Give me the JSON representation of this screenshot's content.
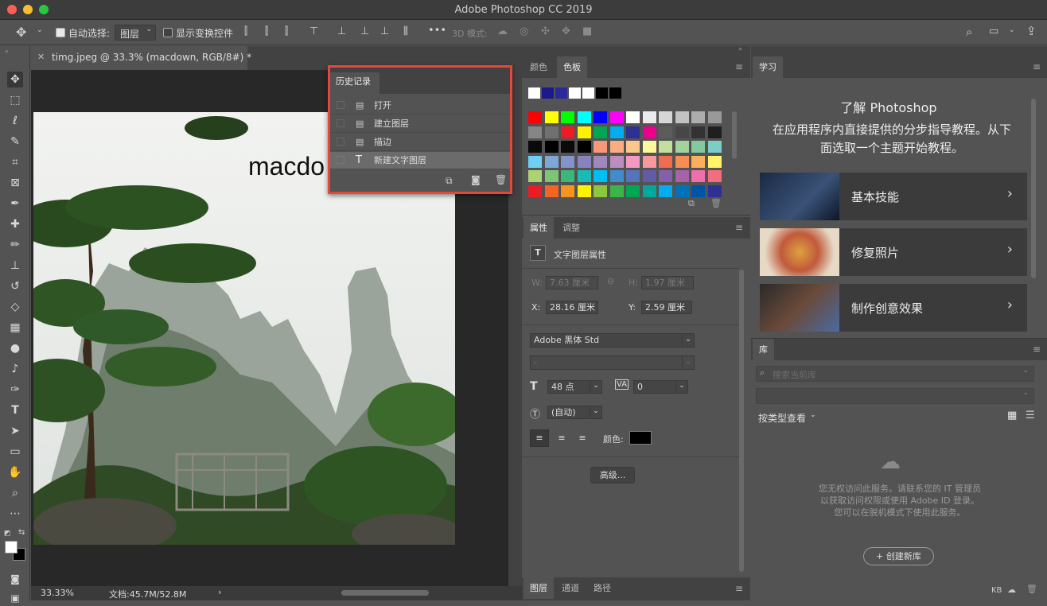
{
  "window": {
    "title": "Adobe Photoshop CC 2019"
  },
  "options_bar": {
    "auto_select_label": "自动选择:",
    "auto_select_target": "图层",
    "show_transform_label": "显示变换控件",
    "mode_3d_label": "3D 模式:",
    "more_label": "•••"
  },
  "document": {
    "tab_title": "timg.jpeg @ 33.3% (macdown, RGB/8#) *",
    "canvas_text": "macdo",
    "zoom": "33.33%",
    "doc_size": "文档:45.7M/52.8M"
  },
  "history": {
    "tab": "历史记录",
    "items": [
      {
        "label": "打开",
        "icon": "document-icon"
      },
      {
        "label": "建立图层",
        "icon": "document-icon"
      },
      {
        "label": "描边",
        "icon": "document-icon"
      },
      {
        "label": "新建文字图层",
        "icon": "text-icon"
      }
    ]
  },
  "swatches_panel": {
    "tabs": [
      "颜色",
      "色板"
    ],
    "recent": [
      "#ffffff",
      "#1a1a8c",
      "#2a2a9a",
      "#ffffff",
      "#ffffff",
      "#000000",
      "#000000"
    ],
    "grid": [
      [
        "#ff0000",
        "#ffff00",
        "#00ff00",
        "#00ffff",
        "#0000ff",
        "#ff00ff",
        "#ffffff",
        "#ebebeb",
        "#d6d6d6",
        "#c2c2c2",
        "#adadad",
        "#999999"
      ],
      [
        "#858585",
        "#707070",
        "#ed1c24",
        "#fff200",
        "#00a651",
        "#00aeef",
        "#2e3192",
        "#ec008c",
        "#5c5c5c",
        "#474747",
        "#333333",
        "#1f1f1f"
      ],
      [
        "#0a0a0a",
        "#000000",
        "#0a0a0a",
        "#000000",
        "#f7977a",
        "#f9ad81",
        "#fdc68a",
        "#fff79a",
        "#c4df9b",
        "#a2d39c",
        "#82ca9d",
        "#7bcdc8"
      ],
      [
        "#6ecff6",
        "#7ea7d8",
        "#8493ca",
        "#8882be",
        "#a187be",
        "#bc8dbf",
        "#f49ac2",
        "#f6989d",
        "#f26c4f",
        "#f68e55",
        "#fbaf5c",
        "#fff467"
      ],
      [
        "#acd372",
        "#7cc576",
        "#3bb878",
        "#1abbb4",
        "#00bff3",
        "#438ccb",
        "#5574b9",
        "#605ca8",
        "#855fa8",
        "#a763a8",
        "#f06eaa",
        "#f26d7d"
      ],
      [
        "#ed1c24",
        "#f26522",
        "#f7941d",
        "#fff200",
        "#8dc73f",
        "#39b54a",
        "#00a651",
        "#00a99d",
        "#00aeef",
        "#0072bc",
        "#0054a6",
        "#2e3192"
      ]
    ]
  },
  "properties_panel": {
    "tabs": [
      "属性",
      "调整"
    ],
    "section_title": "文字图层属性",
    "w_label": "W:",
    "w_value": "7.63 厘米",
    "h_label": "H:",
    "h_value": "1.97 厘米",
    "x_label": "X:",
    "x_value": "28.16 厘米",
    "y_label": "Y:",
    "y_value": "2.59 厘米",
    "font_family": "Adobe 黑体 Std",
    "font_style": "-",
    "font_size": "48 点",
    "tracking": "0",
    "leading": "(自动)",
    "color_label": "颜色:",
    "advanced_button": "高级..."
  },
  "layers_panel": {
    "tabs": [
      "图层",
      "通道",
      "路径"
    ]
  },
  "learn_panel": {
    "tab": "学习",
    "heading": "了解 Photoshop",
    "description": "在应用程序内直接提供的分步指导教程。从下面选取一个主题开始教程。",
    "cards": [
      {
        "label": "基本技能"
      },
      {
        "label": "修复照片"
      },
      {
        "label": "制作创意效果"
      }
    ]
  },
  "library_panel": {
    "tab": "库",
    "search_placeholder": "搜索当前库",
    "view_by": "按类型查看",
    "message": "您无权访问此服务。请联系您的 IT 管理员以获取访问权限或使用 Adobe ID 登录。您可以在脱机模式下使用此服务。",
    "create_button": "+ 创建新库",
    "size_label": "KB"
  }
}
